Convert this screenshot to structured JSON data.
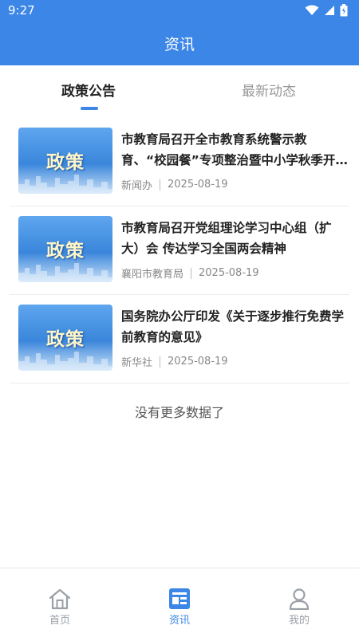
{
  "status": {
    "time": "9:27"
  },
  "header": {
    "title": "资讯"
  },
  "tabs": [
    {
      "label": "政策公告",
      "active": true
    },
    {
      "label": "最新动态",
      "active": false
    }
  ],
  "articles": [
    {
      "thumb_text": "政策",
      "title": "市教育局召开全市教育系统警示教育、“校园餐”专项整治暨中小学秋季开学工作会议",
      "source": "新闻办",
      "date": "2025-08-19"
    },
    {
      "thumb_text": "政策",
      "title": "市教育局召开党组理论学习中心组（扩大）会 传达学习全国两会精神",
      "source": "襄阳市教育局",
      "date": "2025-08-19"
    },
    {
      "thumb_text": "政策",
      "title": "国务院办公厅印发《关于逐步推行免费学前教育的意见》",
      "source": "新华社",
      "date": "2025-08-19"
    }
  ],
  "list_footer": "没有更多数据了",
  "bottom_nav": [
    {
      "label": "首页"
    },
    {
      "label": "资讯"
    },
    {
      "label": "我的"
    }
  ],
  "colors": {
    "accent": "#3b86e6",
    "inactive": "#9aa0a6"
  }
}
